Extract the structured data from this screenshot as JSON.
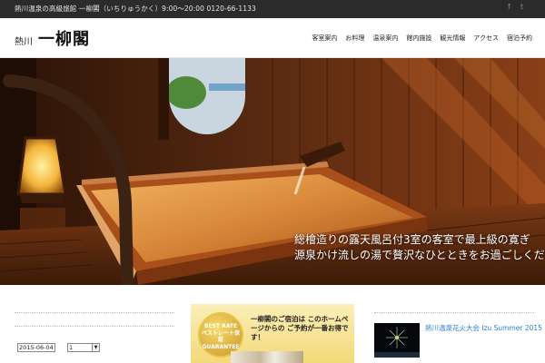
{
  "topbar": {
    "info": "熱川温泉の高級旅館 一柳閣（いちりゅうかく）9:00〜20:00 0120-66-1133",
    "social": {
      "facebook": "f",
      "twitter": "t"
    }
  },
  "header": {
    "logo_place": "熱川",
    "logo_name": "一柳閣"
  },
  "nav": {
    "items": [
      "客室案内",
      "お料理",
      "温泉案内",
      "館内施設",
      "観光情報",
      "アクセス",
      "宿泊予約"
    ]
  },
  "hero": {
    "caption_line1": "総檜造りの露天風呂付3室の客室で最上級の寛ぎ",
    "caption_line2": "源泉かけ流しの湯で贅沢なひとときをお過ごしください"
  },
  "sidebar_left": {
    "date_value": "2015-06-04",
    "select_value": "1"
  },
  "banner": {
    "badge_line1": "BEST RATE",
    "badge_line2": "ベストレート保証",
    "badge_line3": "GUARANTEE",
    "text": "一柳閣のご宿泊は このホームページからの ご予約が一番お得です！"
  },
  "sidebar_right": {
    "post_title": "熱川温泉花火大会 Izu Summer 2015"
  },
  "colors": {
    "topbar_bg": "#2b2b2b",
    "link_blue": "#2a7fd4",
    "banner_gold": "#f3d978"
  }
}
